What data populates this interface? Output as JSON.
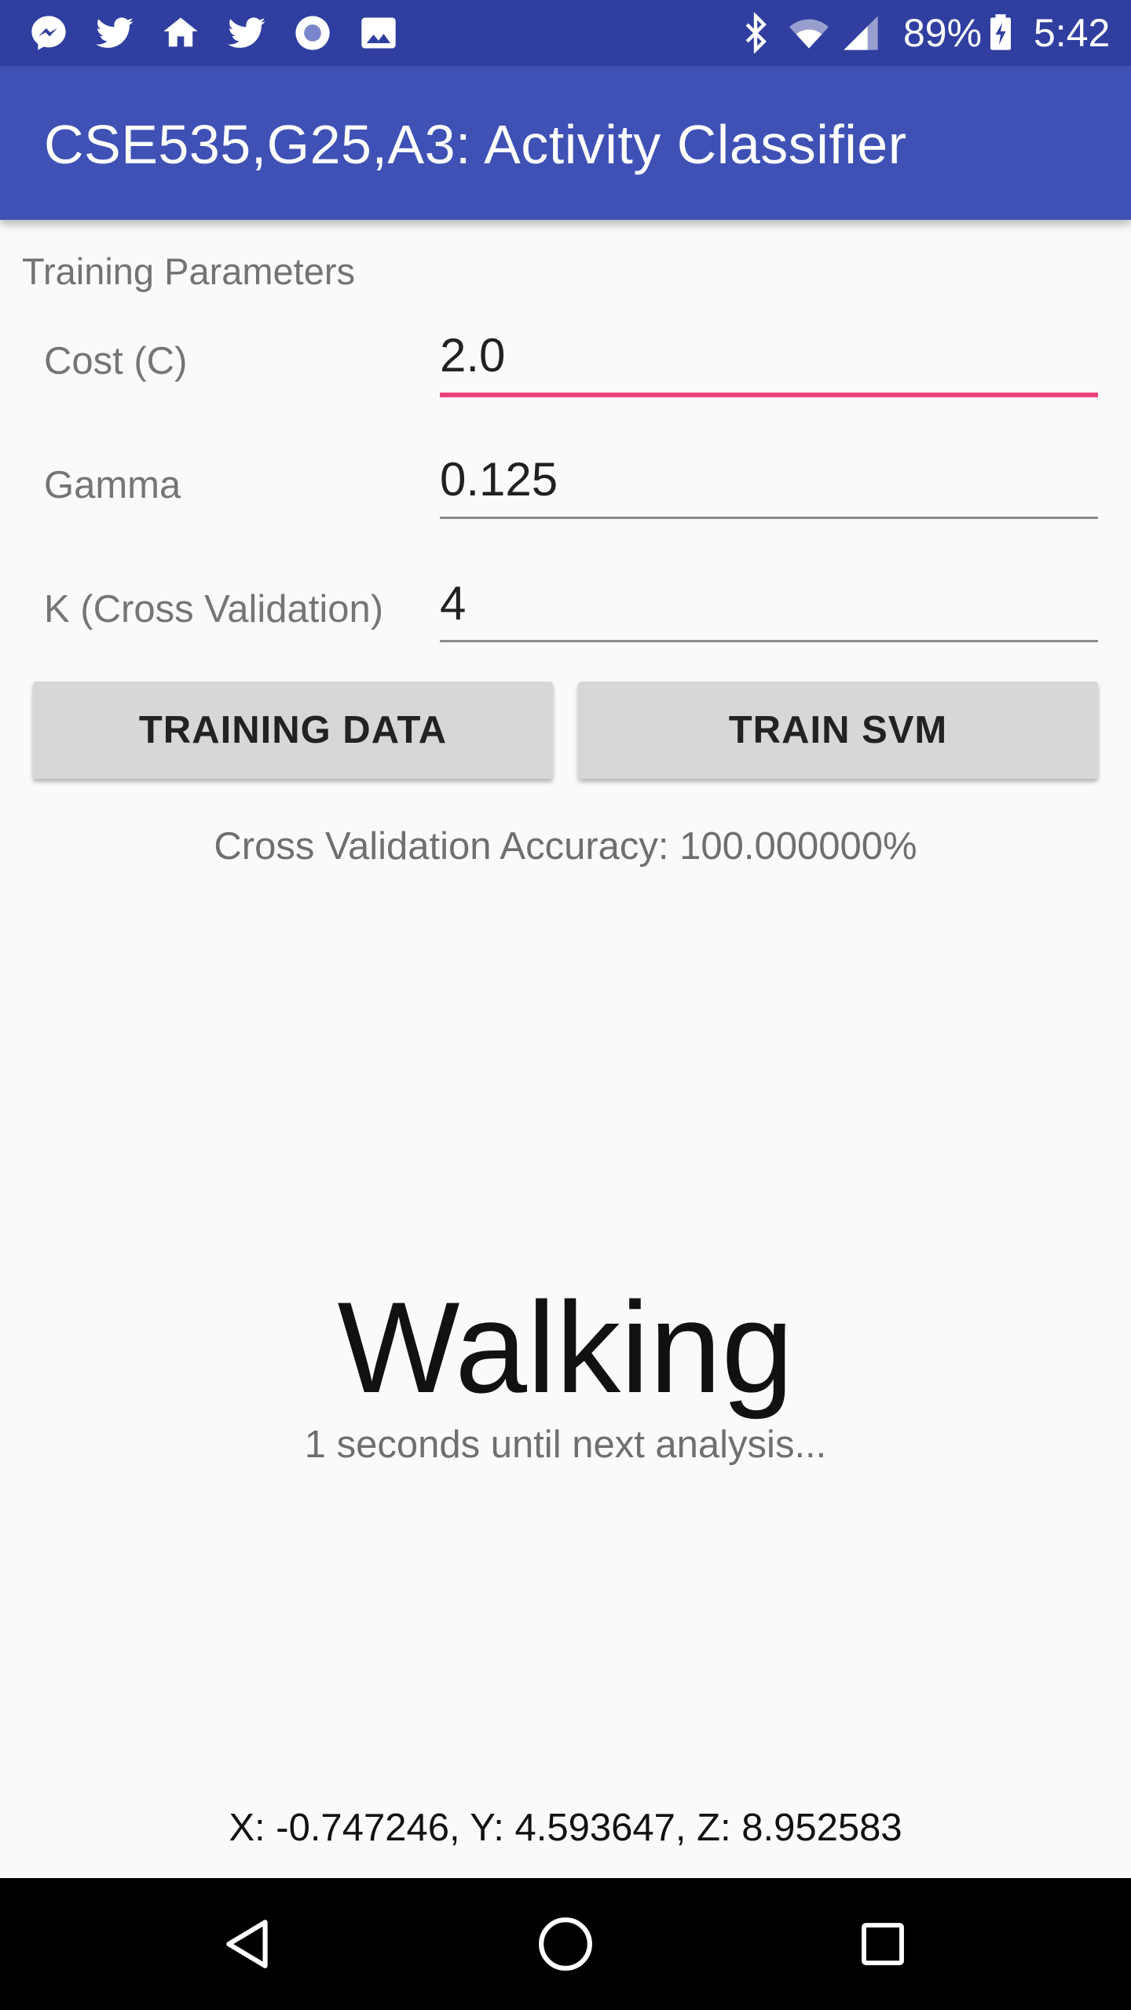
{
  "status_bar": {
    "icons_left": [
      "messenger-icon",
      "twitter-icon",
      "home-icon",
      "twitter-icon",
      "record-icon",
      "image-icon"
    ],
    "battery": "89%",
    "time": "5:42"
  },
  "app_bar": {
    "title": "CSE535,G25,A3: Activity Classifier"
  },
  "params": {
    "section_title": "Training Parameters",
    "cost_label": "Cost (C)",
    "cost_value": "2.0",
    "gamma_label": "Gamma",
    "gamma_value": "0.125",
    "k_label": "K (Cross Validation)",
    "k_value": "4"
  },
  "buttons": {
    "training_data": "TRAINING DATA",
    "train_svm": "TRAIN SVM"
  },
  "results": {
    "accuracy": "Cross Validation Accuracy: 100.000000%",
    "activity": "Walking",
    "countdown": "1 seconds until next analysis...",
    "sensor": "X: -0.747246, Y: 4.593647, Z: 8.952583"
  },
  "colors": {
    "status_bar": "#303f9f",
    "app_bar": "#3f51b5",
    "accent": "#ec407a"
  }
}
